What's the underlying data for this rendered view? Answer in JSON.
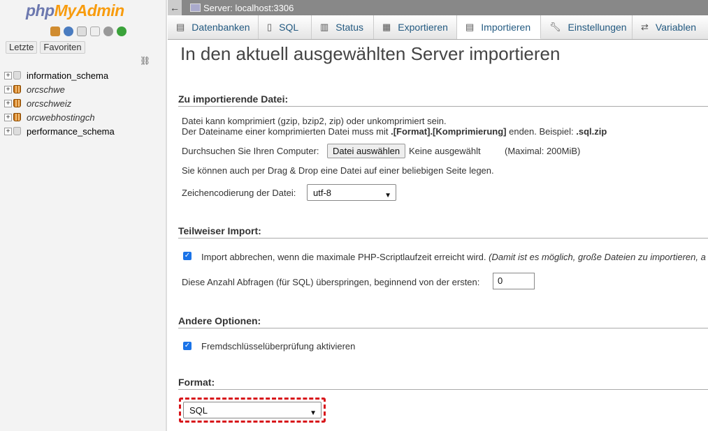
{
  "logo": {
    "part1": "php",
    "part2": "MyAdmin"
  },
  "nav": {
    "recent_label": "Letzte",
    "favorites_label": "Favoriten",
    "databases": [
      {
        "name": "information_schema"
      },
      {
        "name": "orcschwe"
      },
      {
        "name": "orcschweiz"
      },
      {
        "name": "orcwebhostingch"
      },
      {
        "name": "performance_schema"
      }
    ]
  },
  "topbar": {
    "back_icon": "←",
    "server_label": "Server: localhost:3306"
  },
  "tabs": [
    {
      "label": "Datenbanken",
      "icon": "database-icon"
    },
    {
      "label": "SQL",
      "icon": "sql-icon"
    },
    {
      "label": "Status",
      "icon": "status-icon"
    },
    {
      "label": "Exportieren",
      "icon": "export-icon"
    },
    {
      "label": "Importieren",
      "icon": "import-icon"
    },
    {
      "label": "Einstellungen",
      "icon": "wrench-icon"
    },
    {
      "label": "Variablen",
      "icon": "variables-icon"
    }
  ],
  "main": {
    "title": "In den aktuell ausgewählten Server importieren",
    "file_section": {
      "heading": "Zu importierende Datei:",
      "compress_note": "Datei kann komprimiert (gzip, bzip2, zip) oder unkomprimiert sein.",
      "name_note_pre": "Der Dateiname einer komprimierten Datei muss mit ",
      "name_note_bold": ".[Format].[Komprimierung]",
      "name_note_mid": " enden. Beispiel: ",
      "name_note_example": ".sql.zip",
      "browse_label": "Durchsuchen Sie Ihren Computer:",
      "choose_file_button": "Datei auswählen",
      "no_file_text": "Keine ausgewählt",
      "max_size": "(Maximal: 200MiB)",
      "dragdrop_note": "Sie können auch per Drag & Drop eine Datei auf einer beliebigen Seite legen.",
      "charset_label": "Zeichencodierung der Datei:",
      "charset_value": "utf-8"
    },
    "partial_section": {
      "heading": "Teilweiser Import:",
      "abort_label": "Import abbrechen, wenn die maximale PHP-Scriptlaufzeit erreicht wird.",
      "abort_note": "(Damit ist es möglich, große Dateien zu importieren, a",
      "skip_label": "Diese Anzahl Abfragen (für SQL) überspringen, beginnend von der ersten:",
      "skip_value": "0"
    },
    "other_section": {
      "heading": "Andere Optionen:",
      "fk_label": "Fremdschlüsselüberprüfung aktivieren"
    },
    "format_section": {
      "heading": "Format:",
      "format_value": "SQL"
    }
  },
  "colors": {
    "highlight": "#d8161b",
    "tab_link": "#235a81",
    "checkbox": "#1a73e8"
  }
}
